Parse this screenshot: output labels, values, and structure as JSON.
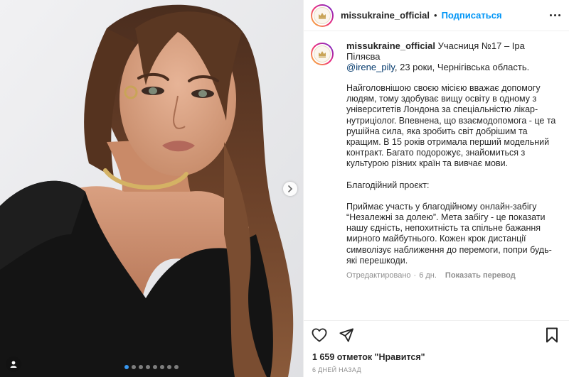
{
  "post": {
    "username": "missukraine_official",
    "separator": "•",
    "follow_label": "Подписаться",
    "more_icon": "more-horizontal-icon",
    "photo_dots": 8,
    "photo_active_index": 0
  },
  "caption": {
    "username": "missukraine_official",
    "line1": "Учасниця №17 – Іра Піляєва",
    "mention": "@irene_pily",
    "line2_rest": ", 23 роки, Чернігівська область.",
    "paragraph1": "Найголовнішою своєю місією вважає допомогу людям, тому здобуває вищу освіту в одному з університетів Лондона за спеціальністю лікар-нутриціолог. Впевнена, що взаємодопомога - це та рушійна сила, яка зробить світ добрішим та кращим. В 15 років отримала перший модельний контракт. Багато подорожує, знайомиться з культурою різних країн та вивчає мови.",
    "paragraph2": "Благодійний проєкт:",
    "paragraph3": "Приймає участь у благодійному онлайн-забігу “Незалежні за долею”. Мета забігу - це показати нашу єдність, непохитність та спільне бажання мирного майбутнього. Кожен крок дистанції символізує наближення до перемоги, попри будь-які перешкоди.",
    "edited": "Отредактировано",
    "dot": "·",
    "age": "6 дн.",
    "translate_label": "Показать перевод"
  },
  "footer": {
    "likes": "1 659 отметок \"Нравится\"",
    "date": "6 ДНЕЙ НАЗАД"
  },
  "colors": {
    "accent": "#0095f6",
    "text": "#262626",
    "muted": "#8e8e8e",
    "mention": "#00376b"
  }
}
